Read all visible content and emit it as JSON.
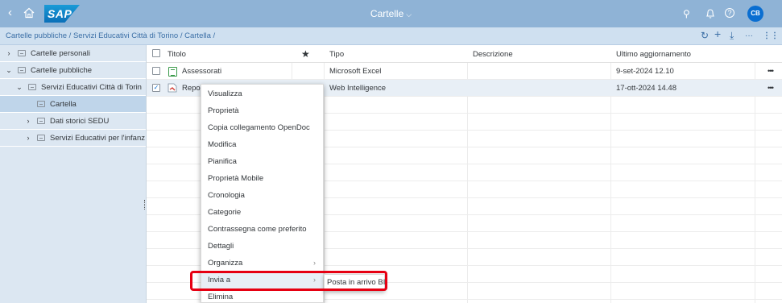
{
  "shell": {
    "back_glyph": "‹",
    "logo": "SAP",
    "title": "Cartelle",
    "title_chevron": "⌵",
    "search_glyph": "⚲",
    "notif_glyph": "♫",
    "help_glyph": "?",
    "avatar": "CB"
  },
  "subbar": {
    "breadcrumb": "Cartelle pubbliche / Servizi Educativi Città di Torino / Cartella /",
    "refresh": "↻",
    "add": "+",
    "upload": "⤓",
    "more": "···",
    "grid": "⋮⋮"
  },
  "tree": {
    "items": [
      {
        "label": "Cartelle personali",
        "expander": "›"
      },
      {
        "label": "Cartelle pubbliche",
        "expander": "⌄"
      },
      {
        "label": "Servizi Educativi Città di Torin",
        "expander": "⌄"
      },
      {
        "label": "Cartella",
        "expander": ""
      },
      {
        "label": "Dati storici SEDU",
        "expander": "›"
      },
      {
        "label": "Servizi Educativi per l'infanz",
        "expander": "›"
      }
    ]
  },
  "table": {
    "headers": {
      "title": "Titolo",
      "star": "★",
      "type": "Tipo",
      "description": "Descrizione",
      "updated": "Ultimo aggiornamento"
    },
    "rows": [
      {
        "title": "Assessorati",
        "type": "Microsoft Excel",
        "description": "",
        "updated": "9-set-2024 12.10",
        "checked": ""
      },
      {
        "title": "Report",
        "type": "Web Intelligence",
        "description": "",
        "updated": "17-ott-2024 14.48",
        "checked": "✓"
      }
    ],
    "more_glyph": "•••"
  },
  "context_menu": {
    "items": [
      "Visualizza",
      "Proprietà",
      "Copia collegamento OpenDoc",
      "Modifica",
      "Pianifica",
      "Proprietà Mobile",
      "Cronologia",
      "Categorie",
      "Contrassegna come preferito",
      "Dettagli",
      "Organizza",
      "Invia a",
      "Elimina"
    ],
    "submenu_arrow": "›",
    "submenu": {
      "item": "Posta in arrivo BI"
    }
  },
  "colors": {
    "shell": "#8fb3d6",
    "accent": "#0a6ed1",
    "highlight_box": "#e60012"
  }
}
